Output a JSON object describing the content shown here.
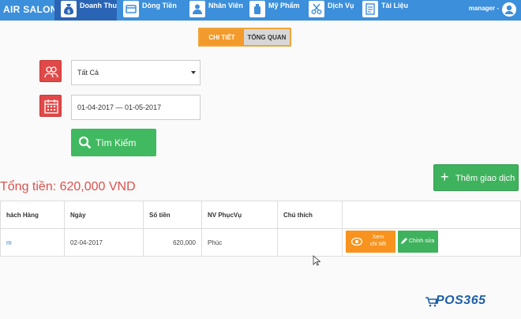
{
  "nav": {
    "brand": "AIR SALON",
    "items": [
      {
        "label": "Doanh Thu",
        "icon": "money-bag-icon"
      },
      {
        "label": "Dòng Tiền",
        "icon": "card-icon"
      },
      {
        "label": "Nhân Viên",
        "icon": "staff-icon"
      },
      {
        "label": "Mỹ Phẩm",
        "icon": "bottle-icon"
      },
      {
        "label": "Dịch Vụ",
        "icon": "scissors-icon"
      },
      {
        "label": "Tài Liệu",
        "icon": "document-icon"
      }
    ],
    "user": "manager -"
  },
  "tabs": {
    "detail": "CHI TIẾT",
    "overview": "TỔNG QUAN"
  },
  "filters": {
    "staff_select_value": "Tất Cả",
    "date_range_value": "01-04-2017 — 01-05-2017",
    "search_label": "Tìm Kiếm"
  },
  "summary": {
    "total_label": "Tổng tiền: 620,000 VND"
  },
  "actions": {
    "add_transaction_label": "Thêm giao dịch"
  },
  "table": {
    "headers": [
      "hách Hàng",
      "Ngày",
      "Số tiền",
      "NV PhụcVụ",
      "Chú thích",
      ""
    ],
    "rows": [
      {
        "customer": "m",
        "date": "02-04-2017",
        "amount": "620,000",
        "staff": "Phúc",
        "note": ""
      }
    ],
    "view_label_1": "Xem",
    "view_label_2": "chi tiết",
    "edit_label": "Chỉnh sửa"
  },
  "watermark": {
    "text": "POS365"
  },
  "colors": {
    "nav_bg": "#3c8fdb",
    "nav_active": "#2a64b5",
    "tab_active": "#f39a2c",
    "filter_icon_bg": "#e14848",
    "success": "#40b960",
    "total_text": "#d9534f",
    "view_button": "#f7931e"
  }
}
